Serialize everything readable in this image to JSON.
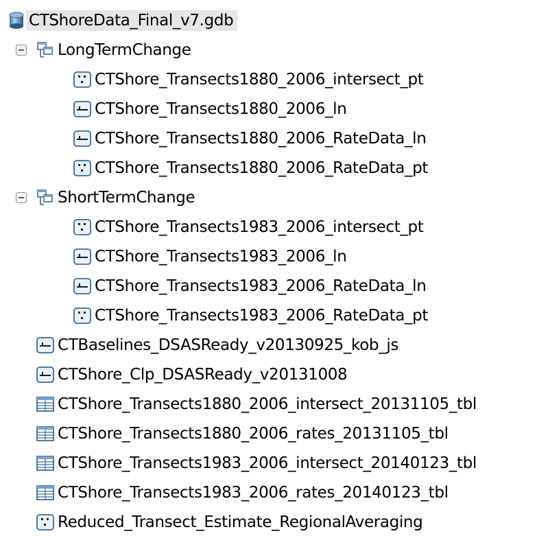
{
  "root": {
    "label": "CTShoreData_Final_v7.gdb",
    "icon": "geodatabase-icon"
  },
  "datasets": [
    {
      "label": "LongTermChange",
      "icon": "feature-dataset-icon",
      "expander": "collapse-icon",
      "children": [
        {
          "label": "CTShore_Transects1880_2006_intersect_pt",
          "icon": "point-feature-class-icon"
        },
        {
          "label": "CTShore_Transects1880_2006_ln",
          "icon": "line-feature-class-icon"
        },
        {
          "label": "CTShore_Transects1880_2006_RateData_ln",
          "icon": "line-feature-class-icon"
        },
        {
          "label": "CTShore_Transects1880_2006_RateData_pt",
          "icon": "point-feature-class-icon"
        }
      ]
    },
    {
      "label": "ShortTermChange",
      "icon": "feature-dataset-icon",
      "expander": "collapse-icon",
      "children": [
        {
          "label": "CTShore_Transects1983_2006_intersect_pt",
          "icon": "point-feature-class-icon"
        },
        {
          "label": "CTShore_Transects1983_2006_ln",
          "icon": "line-feature-class-icon"
        },
        {
          "label": "CTShore_Transects1983_2006_RateData_ln",
          "icon": "line-feature-class-icon"
        },
        {
          "label": "CTShore_Transects1983_2006_RateData_pt",
          "icon": "point-feature-class-icon"
        }
      ]
    }
  ],
  "items": [
    {
      "label": "CTBaselines_DSASReady_v20130925_kob_js",
      "icon": "line-feature-class-icon"
    },
    {
      "label": "CTShore_Clp_DSASReady_v20131008",
      "icon": "line-feature-class-icon"
    },
    {
      "label": "CTShore_Transects1880_2006_intersect_20131105_tbl",
      "icon": "table-icon"
    },
    {
      "label": "CTShore_Transects1880_2006_rates_20131105_tbl",
      "icon": "table-icon"
    },
    {
      "label": "CTShore_Transects1983_2006_intersect_20140123_tbl",
      "icon": "table-icon"
    },
    {
      "label": "CTShore_Transects1983_2006_rates_20140123_tbl",
      "icon": "table-icon"
    },
    {
      "label": "Reduced_Transect_Estimate_RegionalAveraging",
      "icon": "point-feature-class-icon"
    }
  ]
}
